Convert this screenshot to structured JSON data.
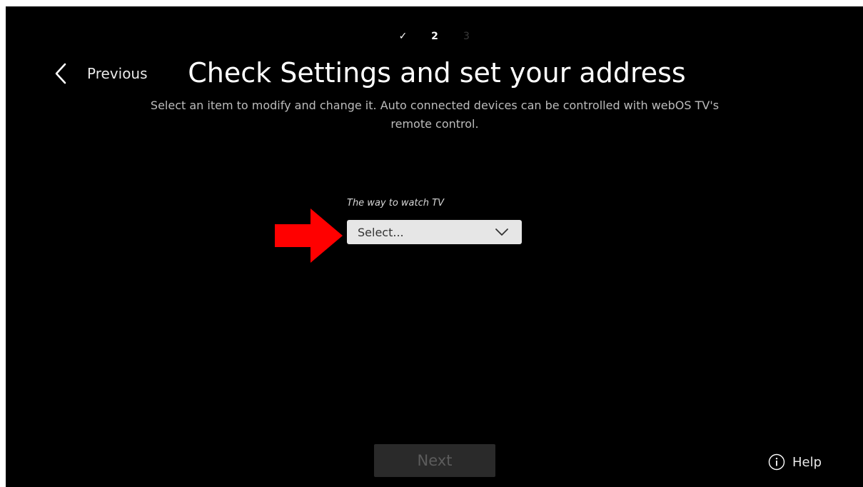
{
  "steps": [
    {
      "label": "✓",
      "state": "done"
    },
    {
      "label": "2",
      "state": "current"
    },
    {
      "label": "3",
      "state": "pending"
    }
  ],
  "header": {
    "previous_label": "Previous",
    "title": "Check Settings and set your address",
    "subtitle": "Select an item to modify and change it. Auto connected devices can be controlled with webOS TV's remote control."
  },
  "form": {
    "watch_tv_label": "The way to watch TV",
    "watch_tv_value": "Select..."
  },
  "footer": {
    "next_label": "Next",
    "help_label": "Help"
  },
  "icons": {
    "previous": "chevron-left-icon",
    "dropdown": "chevron-down-icon",
    "help": "info-circle-icon",
    "annotation": "red-arrow-icon"
  },
  "colors": {
    "background": "#000000",
    "select_bg": "#e6e6e6",
    "next_disabled_bg": "#2a2a2a",
    "annotation_arrow": "#ff0000"
  }
}
